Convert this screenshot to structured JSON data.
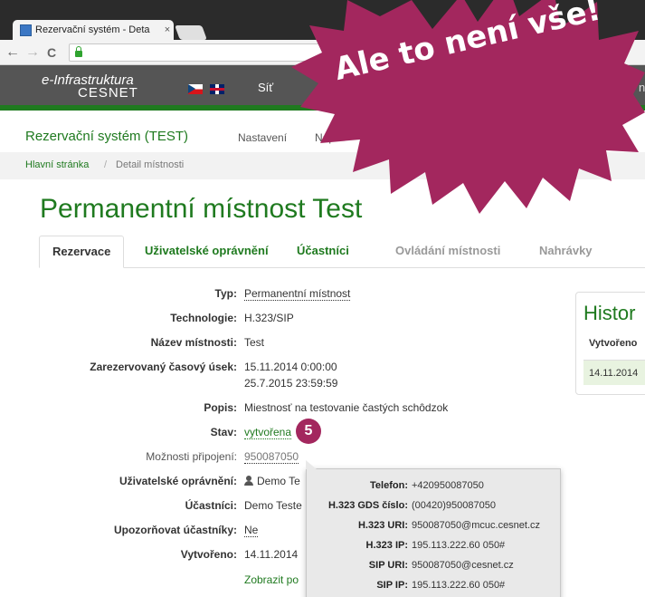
{
  "browser": {
    "tab_title": "Rezervační systém - Deta",
    "tab_close": "×",
    "nav_back": "←",
    "nav_forward": "→",
    "nav_reload": "C"
  },
  "site": {
    "brand_line1": "e-Infrastruktura",
    "brand_line2": "CESNET",
    "nav_item": "Síť",
    "nav_item_right": "n"
  },
  "app": {
    "title": "Rezervační systém (TEST)",
    "menu": [
      "Nastavení",
      "Nápo"
    ]
  },
  "breadcrumb": {
    "home": "Hlavní stránka",
    "separator": "/",
    "current": "Detail místnosti"
  },
  "page": {
    "title": "Permanentní místnost Test"
  },
  "tabs": [
    {
      "label": "Rezervace",
      "state": "active"
    },
    {
      "label": "Uživatelské oprávnění",
      "state": "link"
    },
    {
      "label": "Účastníci",
      "state": "link"
    },
    {
      "label": "Ovládání místnosti",
      "state": "disabled"
    },
    {
      "label": "Nahrávky",
      "state": "disabled"
    }
  ],
  "details": {
    "typ": {
      "label": "Typ:",
      "value": "Permanentní místnost"
    },
    "technologie": {
      "label": "Technologie:",
      "value": "H.323/SIP"
    },
    "nazev": {
      "label": "Název místnosti:",
      "value": "Test"
    },
    "usek": {
      "label": "Zarezervovaný časový úsek:",
      "value_from": "15.11.2014 0:00:00",
      "value_to": "25.7.2015 23:59:59"
    },
    "popis": {
      "label": "Popis:",
      "value": "Miestnosť na testovanie častých schôdzok"
    },
    "stav": {
      "label": "Stav:",
      "value": "vytvořena"
    },
    "moznosti": {
      "label": "Možnosti připojení:",
      "value": "950087050"
    },
    "opravneni": {
      "label": "Uživatelské oprávnění:",
      "value": "Demo Te"
    },
    "ucastnici": {
      "label": "Účastníci:",
      "value": "Demo Teste"
    },
    "upozornovat": {
      "label": "Upozorňovat účastníky:",
      "value": "Ne"
    },
    "vytvoreno": {
      "label": "Vytvořeno:",
      "value": "14.11.2014"
    },
    "zobrazit": "Zobrazit po"
  },
  "history": {
    "title": "Histor",
    "col": "Vytvořeno",
    "row_value": "14.11.2014"
  },
  "popover": {
    "rows": [
      {
        "label": "Telefon:",
        "value": "+420950087050"
      },
      {
        "label": "H.323 GDS číslo:",
        "value": "(00420)950087050"
      },
      {
        "label": "H.323 URI:",
        "value": "950087050@mcuc.cesnet.cz"
      },
      {
        "label": "H.323 IP:",
        "value": "195.113.222.60 050#"
      },
      {
        "label": "SIP URI:",
        "value": "950087050@cesnet.cz"
      },
      {
        "label": "SIP IP:",
        "value": "195.113.222.60 050#"
      }
    ]
  },
  "badge": "5",
  "banner": {
    "text": "Ale to není vše!",
    "color": "#a3275e"
  },
  "colors": {
    "accent_green": "#1f7a1f",
    "header_gray": "#555555"
  }
}
